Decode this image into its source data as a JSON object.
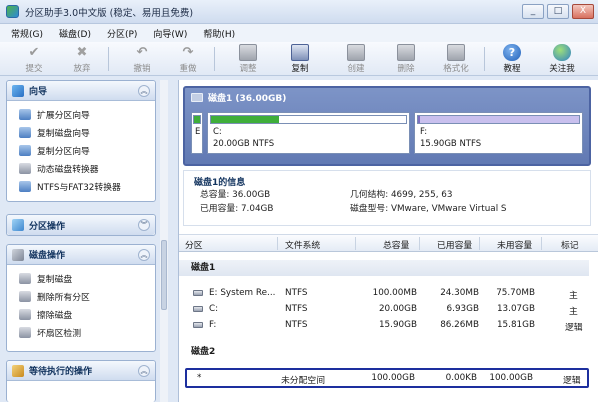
{
  "window": {
    "title": "分区助手3.0中文版 (稳定、易用且免费)",
    "buttons": {
      "minimize": "_",
      "restore": "□",
      "close": "X"
    }
  },
  "menu": [
    "常规(G)",
    "磁盘(D)",
    "分区(P)",
    "向导(W)",
    "帮助(H)"
  ],
  "toolbar": {
    "items": [
      {
        "label": "提交",
        "icon": "check-icon",
        "enabled": false
      },
      {
        "label": "放弃",
        "icon": "x-icon",
        "enabled": false
      },
      {
        "label": "撤销",
        "icon": "undo-icon",
        "enabled": false
      },
      {
        "label": "重做",
        "icon": "redo-icon",
        "enabled": false
      },
      {
        "label": "调整",
        "icon": "resize-drive-icon",
        "enabled": false
      },
      {
        "label": "复制",
        "icon": "copy-drive-icon",
        "enabled": true
      },
      {
        "label": "创建",
        "icon": "create-drive-icon",
        "enabled": false
      },
      {
        "label": "删除",
        "icon": "delete-drive-icon",
        "enabled": false
      },
      {
        "label": "格式化",
        "icon": "format-drive-icon",
        "enabled": false
      },
      {
        "label": "教程",
        "icon": "help-icon",
        "enabled": true
      },
      {
        "label": "关注我",
        "icon": "globe-icon",
        "enabled": true
      }
    ]
  },
  "sidebar": {
    "wizard": {
      "title": "向导",
      "items": [
        "扩展分区向导",
        "复制磁盘向导",
        "复制分区向导",
        "动态磁盘转换器",
        "NTFS与FAT32转换器"
      ]
    },
    "partition_ops": {
      "title": "分区操作"
    },
    "disk_ops": {
      "title": "磁盘操作",
      "items": [
        "复制磁盘",
        "删除所有分区",
        "擦除磁盘",
        "坏扇区检测"
      ]
    },
    "pending": {
      "title": "等待执行的操作"
    }
  },
  "disk_map": {
    "header": "磁盘1 (36.00GB)",
    "partitions": [
      {
        "letter": "E",
        "size": "",
        "color": "#3fae3a"
      },
      {
        "letter": "C:",
        "size": "20.00GB NTFS",
        "fill": 0.35,
        "color": "#3fae3a"
      },
      {
        "letter": "F:",
        "size": "15.90GB NTFS",
        "fill": 0.01,
        "color": "#8a7bc8"
      }
    ]
  },
  "disk_info": {
    "title": "磁盘1的信息",
    "total_label": "总容量: 36.00GB",
    "used_label": "已用容量: 7.04GB",
    "geometry_label": "几何结构: 4699, 255, 63",
    "model_label": "磁盘型号: VMware, VMware Virtual S"
  },
  "table": {
    "columns": [
      "分区",
      "文件系统",
      "总容量",
      "已用容量",
      "未用容量",
      "标记"
    ],
    "groups": [
      {
        "name": "磁盘1",
        "rows": [
          {
            "partition": "E:  System Re...",
            "fs": "NTFS",
            "total": "100.00MB",
            "used": "24.30MB",
            "free": "75.70MB",
            "flag": "主"
          },
          {
            "partition": "C:",
            "fs": "NTFS",
            "total": "20.00GB",
            "used": "6.93GB",
            "free": "13.07GB",
            "flag": "主"
          },
          {
            "partition": "F:",
            "fs": "NTFS",
            "total": "15.90GB",
            "used": "86.26MB",
            "free": "15.81GB",
            "flag": "逻辑"
          }
        ]
      },
      {
        "name": "磁盘2",
        "rows": [
          {
            "partition": "*",
            "fs": "未分配空间",
            "total": "100.00GB",
            "used": "0.00KB",
            "free": "100.00GB",
            "flag": "逻辑"
          }
        ]
      }
    ]
  }
}
